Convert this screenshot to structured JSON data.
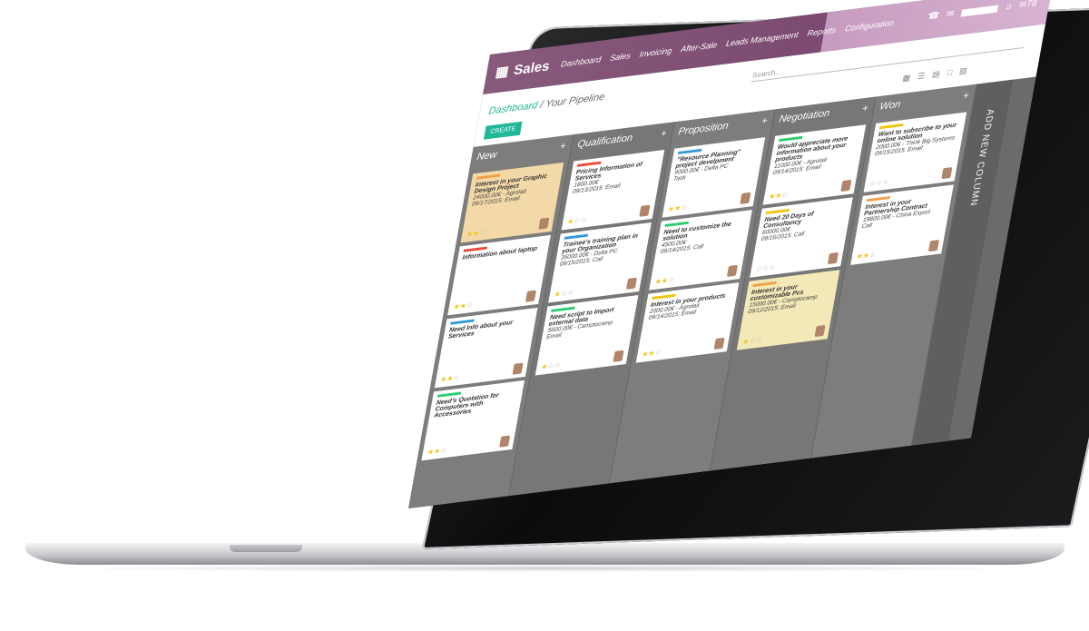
{
  "app": {
    "name": "Sales",
    "notif_count": "78"
  },
  "menu": [
    "Dashboard",
    "Sales",
    "Invoicing",
    "After-Sale",
    "Leads Management",
    "Reports",
    "Configuration"
  ],
  "breadcrumb": {
    "parent": "Dashboard",
    "separator": "/",
    "current": "Your Pipeline"
  },
  "create_label": "CREATE",
  "search_placeholder": "Search...",
  "add_column_label": "ADD NEW COLUMN",
  "columns": [
    {
      "name": "New",
      "cards": [
        {
          "title": "Interest in your Graphic Design Project",
          "line1": "24000.00€ - Agrolait",
          "line2": "09/17/2015: Email",
          "stars": 2,
          "color": "orange"
        },
        {
          "title": "Information about laptop",
          "line1": "",
          "line2": "",
          "stars": 2,
          "color": ""
        },
        {
          "title": "Need Info about your Services",
          "line1": "",
          "line2": "",
          "stars": 2,
          "color": ""
        },
        {
          "title": "Need's Quotation for Computers with Accessories",
          "line1": "",
          "line2": "",
          "stars": 2,
          "color": ""
        }
      ]
    },
    {
      "name": "Qualification",
      "cards": [
        {
          "title": "Pricing Information of Services",
          "line1": "1800.00€",
          "line2": "09/13/2015: Email",
          "stars": 1,
          "color": ""
        },
        {
          "title": "Trainee's training plan in your Organization",
          "line1": "35000.00€ - Delta PC",
          "line2": "09/15/2015: Call",
          "stars": 1,
          "color": ""
        },
        {
          "title": "Need script to Import external data",
          "line1": "5600.00€ - Camptocamp",
          "line2": "Email",
          "stars": 1,
          "color": ""
        }
      ]
    },
    {
      "name": "Proposition",
      "cards": [
        {
          "title": "\"Resource Planning\" project develpment",
          "line1": "9000.00€ - Delta PC",
          "line2": "Task",
          "stars": 2,
          "color": ""
        },
        {
          "title": "Need to customize the solution",
          "line1": "4500.00€",
          "line2": "09/14/2015: Call",
          "stars": 2,
          "color": ""
        },
        {
          "title": "Interest in your products",
          "line1": "2000.00€ - Agrolait",
          "line2": "09/14/2015: Email",
          "stars": 2,
          "color": ""
        }
      ]
    },
    {
      "name": "Negotiation",
      "cards": [
        {
          "title": "Would appreciate more information about your products",
          "line1": "11000.00€ - Agrolait",
          "line2": "09/14/2015: Email",
          "stars": 2,
          "color": ""
        },
        {
          "title": "Need 20 Days of Consultancy",
          "line1": "60000.00€",
          "line2": "09/16/2015: Call",
          "stars": 0,
          "color": ""
        },
        {
          "title": "Interest in your customizable Pcs",
          "line1": "15000.00€ - Camptocamp",
          "line2": "09/12/2015: Email",
          "stars": 1,
          "color": "yellow"
        }
      ]
    },
    {
      "name": "Won",
      "cards": [
        {
          "title": "Want to subscribe to your online solution",
          "line1": "2000.00€ - Think Big Systems",
          "line2": "09/15/2015: Email",
          "stars": 0,
          "color": ""
        },
        {
          "title": "Interest in your Partnership Contract",
          "line1": "19800.00€ - China Export",
          "line2": "Call",
          "stars": 2,
          "color": ""
        }
      ]
    }
  ],
  "bar_colors": [
    "#f0a04b",
    "#e74c3c",
    "#3498db",
    "#2ecc71",
    "#f1c40f"
  ]
}
